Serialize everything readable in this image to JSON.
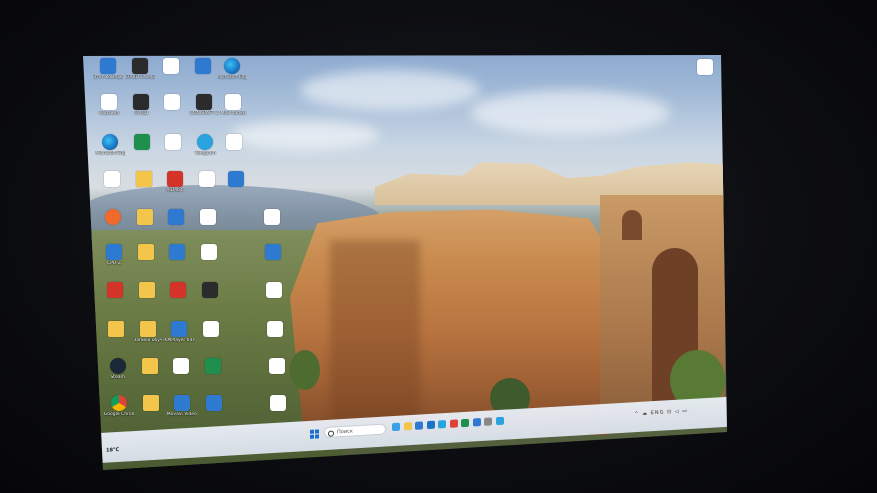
{
  "desktop": {
    "icons": [
      {
        "label": "Этот компьютер",
        "kind": "blue"
      },
      {
        "label": "CPUID HWMonitor",
        "kind": "dark"
      },
      {
        "label": "",
        "kind": "doc"
      },
      {
        "label": "",
        "kind": "blue"
      },
      {
        "label": "Microsoft Edge",
        "kind": "edge"
      },
      {
        "label": "Корзина",
        "kind": "doc"
      },
      {
        "label": "CPUID",
        "kind": "dark"
      },
      {
        "label": "",
        "kind": "doc"
      },
      {
        "label": "CONCRAFT 2",
        "kind": "dark"
      },
      {
        "label": "Мои папки",
        "kind": "doc"
      },
      {
        "label": "Microsoft Edge",
        "kind": "edge"
      },
      {
        "label": "",
        "kind": "green"
      },
      {
        "label": "",
        "kind": "doc"
      },
      {
        "label": "Telegram",
        "kind": "tg"
      },
      {
        "label": "",
        "kind": "doc"
      },
      {
        "label": "",
        "kind": "doc"
      },
      {
        "label": "",
        "kind": "folder"
      },
      {
        "label": "AIDA64",
        "kind": "red"
      },
      {
        "label": "",
        "kind": "doc"
      },
      {
        "label": "",
        "kind": "blue"
      },
      {
        "label": "",
        "kind": "orange"
      },
      {
        "label": "",
        "kind": "folder"
      },
      {
        "label": "",
        "kind": "blue"
      },
      {
        "label": "",
        "kind": "doc"
      },
      {
        "label": "",
        "kind": "doc"
      },
      {
        "label": "CPU-Z",
        "kind": "blue"
      },
      {
        "label": "",
        "kind": "folder"
      },
      {
        "label": "",
        "kind": "blue"
      },
      {
        "label": "",
        "kind": "doc"
      },
      {
        "label": "",
        "kind": "blue"
      },
      {
        "label": "",
        "kind": "red"
      },
      {
        "label": "",
        "kind": "folder"
      },
      {
        "label": "",
        "kind": "red"
      },
      {
        "label": "",
        "kind": "dark"
      },
      {
        "label": "",
        "kind": "doc"
      },
      {
        "label": "",
        "kind": "folder"
      },
      {
        "label": "Записи обучения",
        "kind": "folder"
      },
      {
        "label": "KMPlayer 64X",
        "kind": "blue"
      },
      {
        "label": "",
        "kind": "doc"
      },
      {
        "label": "",
        "kind": "doc"
      },
      {
        "label": "Steam",
        "kind": "steam"
      },
      {
        "label": "",
        "kind": "folder"
      },
      {
        "label": "",
        "kind": "doc"
      },
      {
        "label": "",
        "kind": "green"
      },
      {
        "label": "",
        "kind": "doc"
      },
      {
        "label": "Google Chrome",
        "kind": "chrome"
      },
      {
        "label": "",
        "kind": "folder"
      },
      {
        "label": "Movavi Video Suite",
        "kind": "blue"
      },
      {
        "label": "",
        "kind": "blue"
      },
      {
        "label": "",
        "kind": "doc"
      },
      {
        "label": "",
        "kind": "dark"
      }
    ],
    "top_right_icon": {
      "label": "",
      "kind": "doc"
    }
  },
  "taskbar": {
    "weather_temp": "18°C",
    "weather_text": "",
    "search_placeholder": "Поиск",
    "apps": [
      "#3aa0e8",
      "#f4c54b",
      "#2e7ad1",
      "#1a73c9",
      "#2aa2df",
      "#db4437",
      "#1f8f4e",
      "#2e7ad1",
      "#888888",
      "#2aa2df"
    ],
    "tray_icons": "^ ☁ ENG ⊡ ◁ ▭",
    "time": "",
    "date": ""
  }
}
